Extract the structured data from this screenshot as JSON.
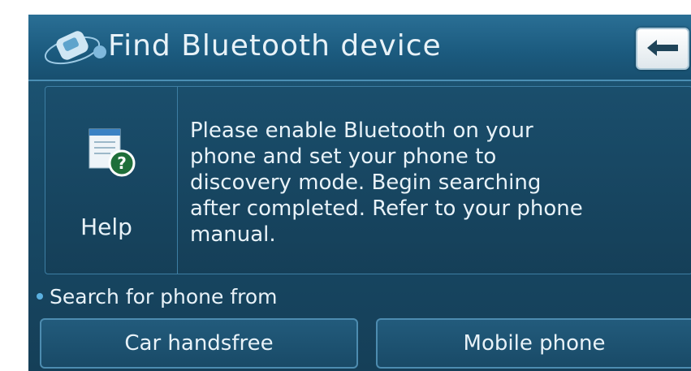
{
  "header": {
    "title": "Find Bluetooth device",
    "icon": "bluetooth-phone-icon",
    "back_icon": "back-arrow-icon"
  },
  "help": {
    "label": "Help",
    "icon": "help-document-icon",
    "message": "Please enable Bluetooth on your\nphone and set your phone to\ndiscovery mode. Begin searching\nafter completed. Refer to your phone\nmanual."
  },
  "search": {
    "label": "Search for phone from",
    "options": [
      "Car handsfree",
      "Mobile phone"
    ]
  },
  "colors": {
    "background": "#184a67",
    "titlebar": "#1b5a7e",
    "border": "#3d7ea3",
    "text": "#e8f2f8"
  }
}
